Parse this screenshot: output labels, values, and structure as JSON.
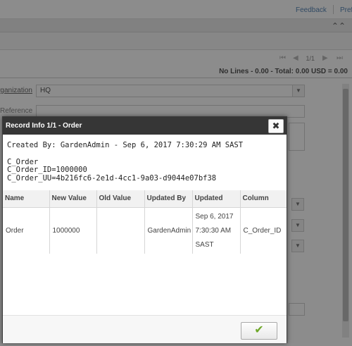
{
  "topbar": {
    "feedback": "Feedback",
    "preferences": "Pref"
  },
  "nav": {
    "record_counter": "1/1"
  },
  "status": {
    "text": "No Lines - 0.00 - Total: 0.00 USD = 0.00"
  },
  "form": {
    "organization_label": "Organization",
    "organization_value": "HQ",
    "reference_label": "Reference",
    "partial_label_fragment": "r"
  },
  "dialog": {
    "title": "Record Info 1/1 - Order",
    "close_glyph": "✖",
    "created_line": "Created By: GardenAdmin - Sep 6, 2017 7:30:29 AM SAST",
    "table_name": "C_Order",
    "id_line": "C_Order_ID=1000000",
    "uu_line": "C_Order_UU=4b216fc6-2e1d-4cc1-9a03-d9044e07bf38",
    "columns": [
      "Name",
      "New Value",
      "Old Value",
      "Updated By",
      "Updated",
      "Column"
    ],
    "rows": [
      {
        "name": "Order",
        "new_value": "1000000",
        "old_value": "",
        "updated_by": "GardenAdmin",
        "updated": [
          "Sep 6, 2017",
          "7:30:30 AM",
          "SAST"
        ],
        "column": "C_Order_ID"
      }
    ],
    "ok_glyph": "✔"
  },
  "colors": {
    "header_bg": "#363636",
    "ok_check": "#6fa82a",
    "overlay": "rgba(0,0,0,0.45)"
  }
}
